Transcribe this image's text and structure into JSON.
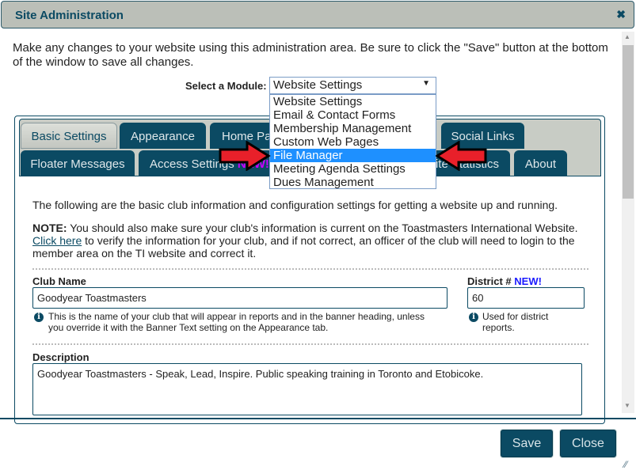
{
  "dialog": {
    "title": "Site Administration",
    "close_icon": "close-icon"
  },
  "intro": "Make any changes to your website using this administration area. Be sure to click the \"Save\" button at the bottom of the window to save all changes.",
  "module_select": {
    "label": "Select a Module:",
    "value": "Website Settings",
    "options": [
      "Website Settings",
      "Email & Contact Forms",
      "Membership Management",
      "Custom Web Pages",
      "File Manager",
      "Meeting Agenda Settings",
      "Dues Management"
    ],
    "highlighted": "File Manager",
    "highlight_color": "#1e90ff"
  },
  "tabs": {
    "row1": [
      "Basic Settings",
      "Appearance",
      "Home Pa",
      "Social Links"
    ],
    "row2": [
      "Floater Messages",
      "Access Settings",
      "site Statistics",
      "About"
    ],
    "new_badge": "NEW!",
    "active": "Basic Settings"
  },
  "content": {
    "intro": "The following are the basic club information and configuration settings for getting a website up and running.",
    "note_label": "NOTE:",
    "note_text": " You should also make sure your club's information is current on the Toastmasters International Website.",
    "link": "Click here",
    "note_rest": " to verify the information for your club, and if not correct, an officer of the club will need to login to the member area on the TI website and correct it.",
    "club_name_label": "Club Name",
    "club_name_value": "Goodyear Toastmasters",
    "club_name_help": "This is the name of your club that will appear in reports and in the banner heading, unless you override it with the Banner Text setting on the Appearance tab.",
    "district_label": "District #",
    "district_new": "NEW!",
    "district_value": "60",
    "district_help": "Used for district reports.",
    "description_label": "Description",
    "description_value": "Goodyear Toastmasters - Speak, Lead, Inspire. Public speaking training in Toronto and Etobicoke."
  },
  "footer": {
    "save": "Save",
    "close": "Close"
  },
  "colors": {
    "primary": "#0b4a63",
    "arrow": "#e8202a"
  }
}
